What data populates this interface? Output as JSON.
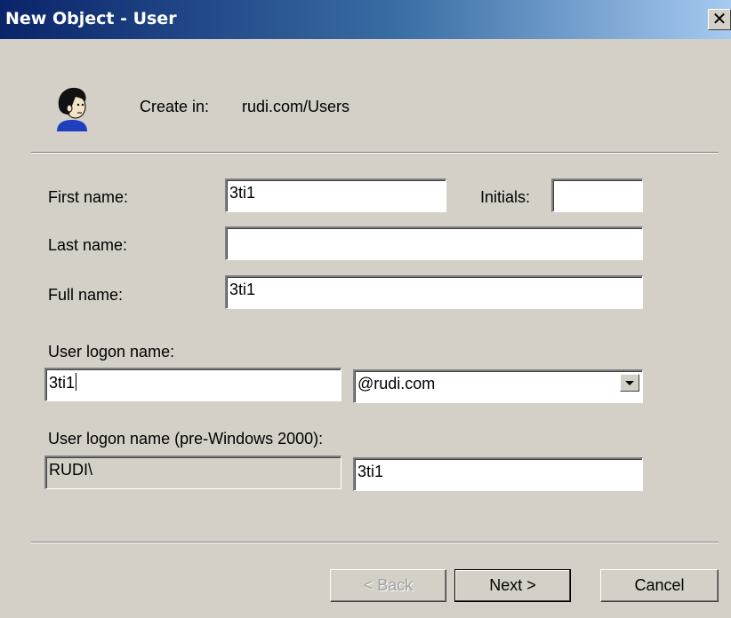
{
  "window": {
    "title": "New Object - User",
    "close_glyph": "✕"
  },
  "header": {
    "icon": "user-icon",
    "create_in_label": "Create in:",
    "create_in_value": "rudi.com/Users"
  },
  "form": {
    "first_name_label": "First name:",
    "first_name_value": "3ti1",
    "initials_label": "Initials:",
    "initials_value": "",
    "last_name_label": "Last name:",
    "last_name_value": "",
    "full_name_label": "Full name:",
    "full_name_value": "3ti1",
    "logon_name_label": "User logon name:",
    "logon_name_value": "3ti1",
    "domain_selected": "@rudi.com",
    "pre2000_label": "User logon name (pre-Windows 2000):",
    "pre2000_domain": "RUDI\\",
    "pre2000_value": "3ti1"
  },
  "buttons": {
    "back": "< Back",
    "next": "Next >",
    "cancel": "Cancel"
  }
}
